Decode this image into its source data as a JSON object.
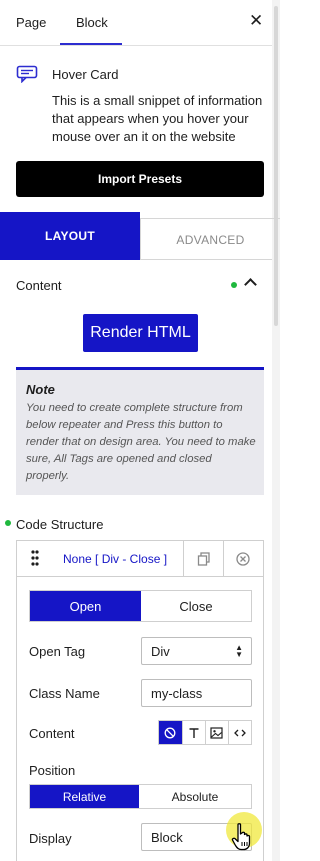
{
  "top_tabs": {
    "page": "Page",
    "block": "Block",
    "close_icon": "close-icon"
  },
  "card": {
    "icon": "message-icon",
    "title": "Hover Card",
    "description": "This is a small snippet of information that appears when you hover your mouse over an it on the website"
  },
  "import_presets_label": "Import Presets",
  "layout_tabs": {
    "layout": "LAYOUT",
    "advanced": "ADVANCED"
  },
  "content_section": {
    "title": "Content",
    "status_color": "#1fb83e"
  },
  "render_button_label": "Render HTML",
  "note": {
    "title": "Note",
    "text": "You need to create complete structure from below repeater and Press this button to render that on design area. You need to make sure, All Tags are opened and closed properly."
  },
  "code_structure": {
    "label": "Code Structure",
    "item_title": "None [ Div - Close ]",
    "mode_tabs": {
      "open": "Open",
      "close": "Close"
    },
    "open_tag": {
      "label": "Open Tag",
      "value": "Div"
    },
    "class_name": {
      "label": "Class Name",
      "value": "my-class"
    },
    "content": {
      "label": "Content",
      "tools": [
        "none-icon",
        "text-icon",
        "image-icon",
        "code-icon"
      ]
    },
    "position": {
      "label": "Position",
      "options": [
        "Relative",
        "Absolute"
      ],
      "selected": "Relative"
    },
    "display": {
      "label": "Display",
      "value": "Block"
    }
  },
  "accent_color": "#1515c6"
}
